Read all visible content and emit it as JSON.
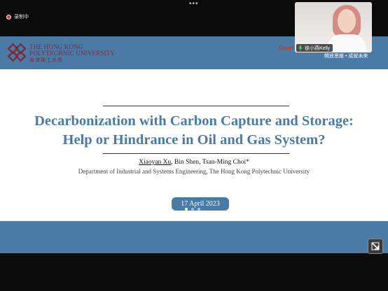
{
  "recording": {
    "label": "录制中"
  },
  "slide": {
    "logo": {
      "name_line1": "The Hong Kong",
      "name_line2": "Polytechnic University",
      "name_zh": "香港理工大學"
    },
    "open_text": "Open",
    "open_subtext": "開放思維 • 成就未來",
    "title_line1": "Decarbonization with Carbon Capture and Storage:",
    "title_line2": "Help or Hindrance in Oil and Gas System?",
    "author_first": "Xiaoyan Xu",
    "author_rest": ", Bin Shen, Tsan-Ming Choi*",
    "affiliation": "Department of Industrial and Systems Engineering, The Hong Kong Polytechnic University",
    "date": "17 April 2023",
    "pager": {
      "total": 3,
      "current": 1
    }
  },
  "participant": {
    "name": "徐小燕Kelly"
  },
  "colors": {
    "accent": "#4a7ba7",
    "logo": "#7a2a3a",
    "record": "#e53935"
  },
  "icons": [
    "more-dots-icon",
    "record-icon",
    "polyu-logo-icon",
    "mic-icon",
    "expand-icon"
  ]
}
